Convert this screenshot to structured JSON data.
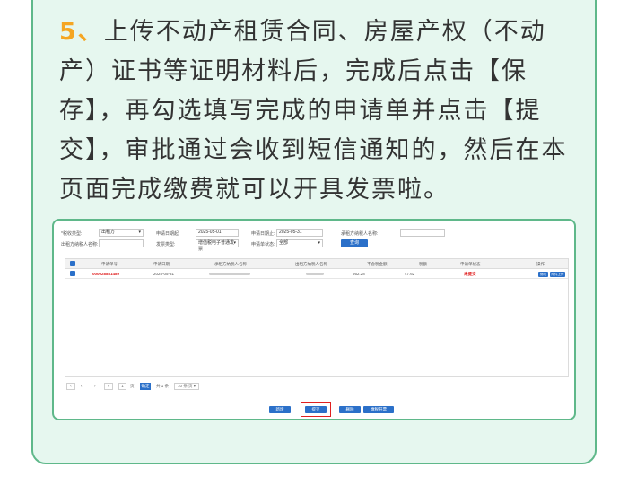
{
  "instruction": {
    "step_number": "5、",
    "text": "上传不动产租赁合同、房屋产权（不动产）证书等证明材料后，完成后点击【保存】，再勾选填写完成的申请单并点击【提交】，审批通过会收到短信通知的，然后在本页面完成缴费就可以开具发票啦。"
  },
  "form": {
    "business_type_label": "*税收类型:",
    "business_type_value": "出租方",
    "apply_start_label": "申请日期起:",
    "apply_start_value": "2025-05-01",
    "apply_end_label": "申请日期止:",
    "apply_end_value": "2025-05-31",
    "lessor_taxpayer_label": "承租方纳税人名称:",
    "lessee_taxpayer_label": "出租方纳税人名称:",
    "invoice_type_label": "发票类型:",
    "invoice_type_value": "增值税电子普通发票",
    "status_label": "申请单状态:",
    "status_value": "全部",
    "query_button": "查询"
  },
  "table": {
    "headers": [
      "申请单号",
      "申请日期",
      "承租方纳税人名称",
      "出租方纳税人名称",
      "不含税金额",
      "税额",
      "申请单状态",
      "操作"
    ],
    "rows": [
      {
        "id": "000028881489",
        "date": "2025-05-31",
        "amount": "952.28",
        "tax": "47.62",
        "status": "未提交",
        "actions": [
          "修改",
          "附件上传"
        ]
      }
    ]
  },
  "pager": {
    "page": "1",
    "jump_label": "页",
    "go_button": "确定",
    "total": "共 1 条",
    "page_size": "10 条/页"
  },
  "actions": {
    "add": "新增",
    "submit": "提交",
    "delete": "删除",
    "pay": "缴税开票"
  },
  "colors": {
    "accent": "#2b70c9",
    "frame": "#5fb88a",
    "step": "#f5a623",
    "alert": "#e02020"
  }
}
